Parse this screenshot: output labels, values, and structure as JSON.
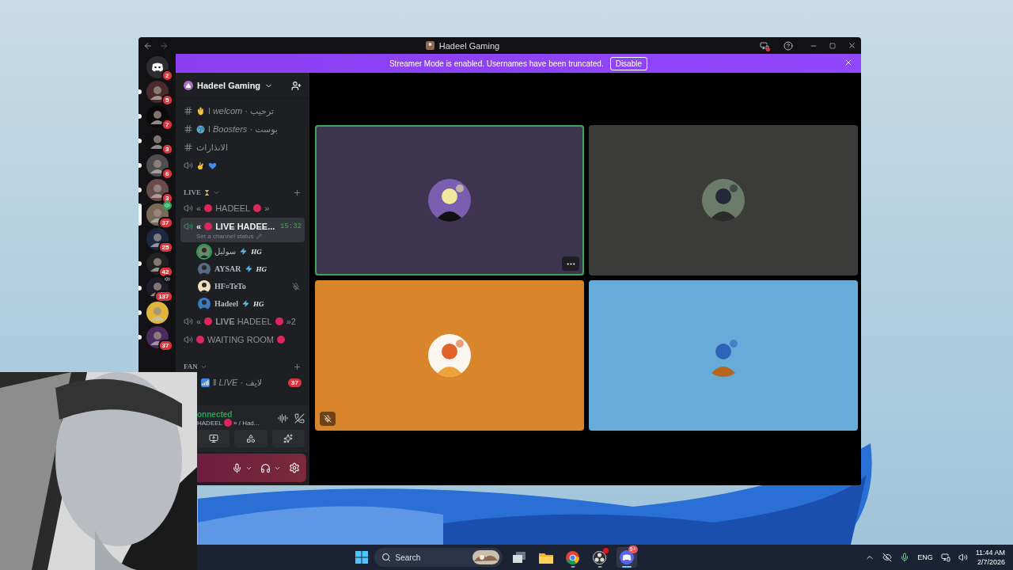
{
  "window": {
    "title": "Hadeel Gaming"
  },
  "banner": {
    "text": "Streamer Mode is enabled. Usernames have been truncated.",
    "button": "Disable"
  },
  "servers": [
    {
      "kind": "home",
      "badge": "2",
      "unread": false,
      "selected": false,
      "voice": false
    },
    {
      "kind": "server",
      "badge": "5",
      "unread": true,
      "selected": false,
      "voice": false
    },
    {
      "kind": "server",
      "badge": "7",
      "unread": true,
      "selected": false,
      "voice": false
    },
    {
      "kind": "server",
      "badge": "3",
      "unread": true,
      "selected": false,
      "voice": false
    },
    {
      "kind": "server",
      "badge": "6",
      "unread": true,
      "selected": false,
      "voice": false
    },
    {
      "kind": "server",
      "badge": "3",
      "unread": true,
      "selected": false,
      "voice": false
    },
    {
      "kind": "server",
      "badge": "37",
      "unread": false,
      "selected": true,
      "voice": true
    },
    {
      "kind": "server",
      "badge": "25",
      "unread": false,
      "selected": false,
      "voice": false
    },
    {
      "kind": "server",
      "badge": "42",
      "unread": true,
      "selected": false,
      "voice": false
    },
    {
      "kind": "server",
      "badge": "137",
      "unread": true,
      "selected": false,
      "voice": true
    },
    {
      "kind": "server",
      "unread": true,
      "selected": false,
      "voice": false
    },
    {
      "kind": "server",
      "badge": "37",
      "unread": true,
      "selected": false,
      "voice": false
    }
  ],
  "sidebar": {
    "server_name": "Hadeel Gaming",
    "channels": [
      {
        "kind": "text",
        "selected": false,
        "segments": [
          {
            "kind": "wave"
          },
          {
            "kind": "text",
            "text": "ǀ *welcom* · ترحيب"
          }
        ]
      },
      {
        "kind": "text",
        "selected": false,
        "segments": [
          {
            "kind": "globe"
          },
          {
            "kind": "text",
            "text": "ǀ *Boosters* · بوست"
          }
        ]
      },
      {
        "kind": "text",
        "selected": false,
        "segments": [
          {
            "kind": "text",
            "text": "الانذارات"
          }
        ]
      },
      {
        "kind": "voice",
        "selected": false,
        "segments": [
          {
            "kind": "ok-hand"
          },
          {
            "kind": "heart"
          }
        ]
      }
    ],
    "categories": [
      {
        "segments": [
          {
            "kind": "text",
            "text": "LIVE"
          },
          {
            "kind": "hourglass"
          }
        ],
        "expanded": true,
        "channels": [
          {
            "kind": "voice",
            "selected": false,
            "segments": [
              {
                "kind": "text",
                "text": "«"
              },
              {
                "kind": "dot"
              },
              {
                "kind": "text",
                "text": "HADEEL"
              },
              {
                "kind": "dot"
              },
              {
                "kind": "text",
                "text": "»"
              }
            ]
          },
          {
            "kind": "voice",
            "selected": true,
            "connected": true,
            "time": "15:32",
            "status": "Set a channel status",
            "segments": [
              {
                "kind": "text",
                "text": "«"
              },
              {
                "kind": "dot"
              },
              {
                "kind": "text",
                "text": "**LIVE** HADEE..."
              }
            ],
            "children": [
              {
                "name": "سوليل",
                "tag": "HG",
                "speaking": true,
                "muted": false,
                "serif": false
              },
              {
                "name": "AYSAR",
                "tag": "HG",
                "speaking": false,
                "muted": false,
                "serif": true
              },
              {
                "name": "HF¤TeTo",
                "speaking": false,
                "muted": true,
                "serif": true
              },
              {
                "name": "Hadeel",
                "tag": "HG",
                "speaking": false,
                "muted": false,
                "serif": true
              }
            ]
          },
          {
            "kind": "voice",
            "selected": false,
            "segments": [
              {
                "kind": "text",
                "text": "«"
              },
              {
                "kind": "dot"
              },
              {
                "kind": "text",
                "text": "**LIVE** HADEEL"
              },
              {
                "kind": "dot"
              },
              {
                "kind": "text",
                "text": "»2"
              }
            ]
          },
          {
            "kind": "voice",
            "selected": false,
            "segments": [
              {
                "kind": "dot"
              },
              {
                "kind": "text",
                "text": "WAITING ROOM"
              },
              {
                "kind": "dot"
              }
            ]
          }
        ]
      },
      {
        "segments": [
          {
            "kind": "text",
            "text": "FAN"
          }
        ],
        "expanded": true,
        "channels": [
          {
            "kind": "text",
            "selected": false,
            "badge": "37",
            "segments": [
              {
                "kind": "signal"
              },
              {
                "kind": "text",
                "text": "ǁ *LIVE* · لايف"
              }
            ]
          }
        ]
      }
    ]
  },
  "voice_panel": {
    "status": "onnected",
    "segments": [
      {
        "kind": "text",
        "text": "HADEEL"
      },
      {
        "kind": "dot"
      },
      {
        "kind": "text",
        "text": "» / Had..."
      }
    ]
  },
  "tiles": [
    {
      "color": "#3d3450",
      "speaking": true,
      "muted": false,
      "show_menu": true
    },
    {
      "color": "#3b3b39",
      "speaking": false,
      "muted": false,
      "show_menu": false
    },
    {
      "color": "#d9852c",
      "speaking": false,
      "muted": true,
      "show_menu": false
    },
    {
      "color": "#67acd8",
      "speaking": false,
      "muted": false,
      "show_menu": false
    }
  ],
  "taskbar": {
    "search": {
      "placeholder": "Search"
    },
    "apps": [
      {
        "kind": "task-view",
        "running": false,
        "active": false
      },
      {
        "kind": "explorer",
        "running": false,
        "active": false
      },
      {
        "kind": "chrome",
        "running": true,
        "active": false
      },
      {
        "kind": "obs",
        "running": true,
        "active": false,
        "alert": true
      },
      {
        "kind": "discord",
        "running": true,
        "active": true,
        "badge": "9+"
      }
    ],
    "language": "ENG",
    "time": "11:44 AM",
    "date": "2/7/2026"
  }
}
